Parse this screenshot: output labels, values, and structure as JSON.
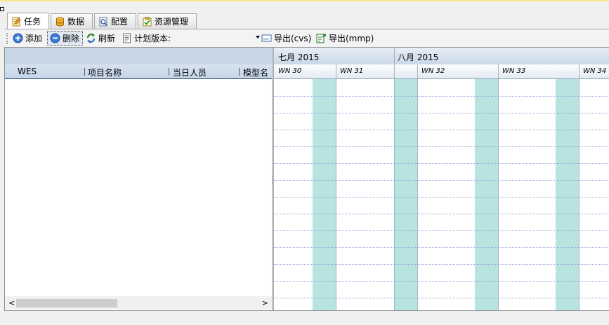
{
  "tabs": [
    {
      "label": "任务",
      "icon": "task-icon"
    },
    {
      "label": "数据",
      "icon": "database-icon"
    },
    {
      "label": "配置",
      "icon": "config-icon"
    },
    {
      "label": "资源管理",
      "icon": "resource-icon"
    }
  ],
  "toolbar": {
    "add_label": "添加",
    "delete_label": "删除",
    "refresh_label": "刷新",
    "plan_version_label": "计划版本:",
    "plan_version_value": "",
    "export_cvs_label": "导出(cvs)",
    "export_mmp_label": "导出(mmp)"
  },
  "grid": {
    "columns": [
      "WES",
      "项目名称",
      "当日人员",
      "模型名"
    ]
  },
  "gantt": {
    "months": [
      "七月 2015",
      "八月 2015"
    ],
    "weeks": [
      "WN 30",
      "WN 31",
      "WN 32",
      "WN 33",
      "WN 34"
    ]
  },
  "colors": {
    "weekend": "#b7e4e1",
    "header": "#c8d7e6"
  }
}
